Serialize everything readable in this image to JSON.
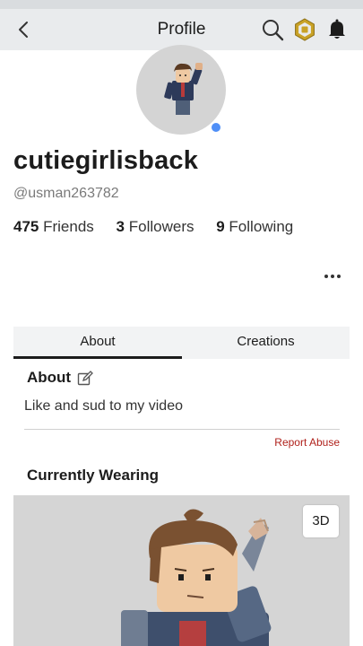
{
  "header": {
    "title": "Profile",
    "icons": {
      "back": "chevron-left-icon",
      "search": "search-icon",
      "robux": "robux-icon",
      "notifications": "bell-icon"
    }
  },
  "profile": {
    "display_name": "cutiegirlisback",
    "handle": "@usman263782",
    "friends_count": "475",
    "friends_label": "Friends",
    "followers_count": "3",
    "followers_label": "Followers",
    "following_count": "9",
    "following_label": "Following",
    "status_color": "#4f8ff7"
  },
  "tabs": [
    {
      "label": "About",
      "active": true
    },
    {
      "label": "Creations",
      "active": false
    }
  ],
  "about": {
    "title": "About",
    "description": "Like and sud to my video",
    "report_label": "Report Abuse"
  },
  "wearing": {
    "title": "Currently Wearing",
    "view_3d_label": "3D"
  }
}
